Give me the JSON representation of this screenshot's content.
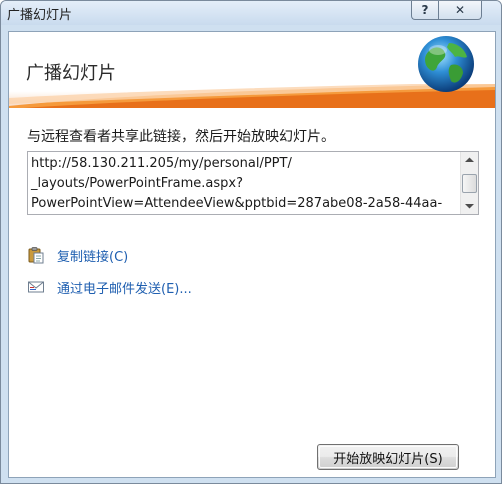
{
  "window": {
    "title": "广播幻灯片",
    "help_label": "?",
    "close_label": "✕"
  },
  "banner": {
    "title": "广播幻灯片"
  },
  "instruction": "与远程查看者共享此链接，然后开始放映幻灯片。",
  "url_box": {
    "line1": "http://58.130.211.205/my/personal/PPT/",
    "line2": "_layouts/PowerPointFrame.aspx?",
    "line3": "PowerPointView=AttendeeView&pptbid=287abe08-2a58-44aa-"
  },
  "links": {
    "copy_label": "复制链接(C)",
    "email_label": "通过电子邮件发送(E)..."
  },
  "buttons": {
    "start_label": "开始放映幻灯片(S)"
  },
  "icons": {
    "globe": "globe-icon",
    "copy": "clipboard-icon",
    "email": "email-icon"
  },
  "colors": {
    "link": "#1f5fb0",
    "banner_accent": "#e8701a"
  }
}
